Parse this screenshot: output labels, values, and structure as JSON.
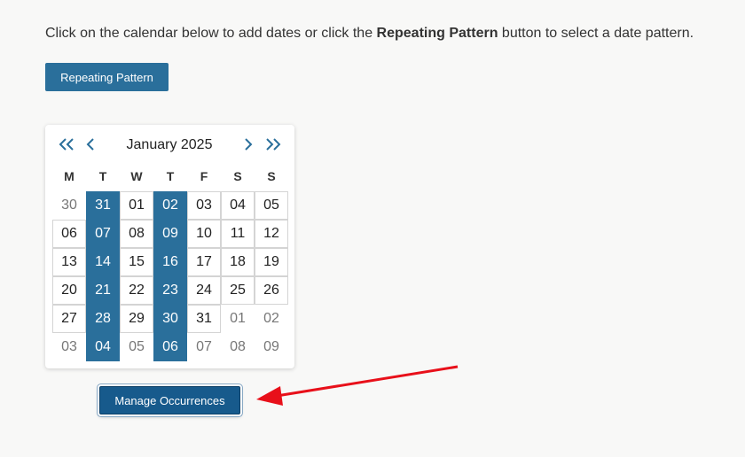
{
  "intro": {
    "before": "Click on the calendar below to add dates or click the ",
    "bold": "Repeating Pattern",
    "after": " button to select a date pattern."
  },
  "repeat_button": {
    "label": "Repeating Pattern"
  },
  "calendar": {
    "month_label": "January 2025",
    "weekdays": [
      "M",
      "T",
      "W",
      "T",
      "F",
      "S",
      "S"
    ],
    "weeks": [
      [
        {
          "d": "30",
          "state": "outside"
        },
        {
          "d": "31",
          "state": "selected"
        },
        {
          "d": "01",
          "state": "current"
        },
        {
          "d": "02",
          "state": "selected"
        },
        {
          "d": "03",
          "state": "current"
        },
        {
          "d": "04",
          "state": "current"
        },
        {
          "d": "05",
          "state": "current"
        }
      ],
      [
        {
          "d": "06",
          "state": "current"
        },
        {
          "d": "07",
          "state": "selected"
        },
        {
          "d": "08",
          "state": "current"
        },
        {
          "d": "09",
          "state": "selected"
        },
        {
          "d": "10",
          "state": "current"
        },
        {
          "d": "11",
          "state": "current"
        },
        {
          "d": "12",
          "state": "current"
        }
      ],
      [
        {
          "d": "13",
          "state": "current"
        },
        {
          "d": "14",
          "state": "selected"
        },
        {
          "d": "15",
          "state": "current"
        },
        {
          "d": "16",
          "state": "selected"
        },
        {
          "d": "17",
          "state": "current"
        },
        {
          "d": "18",
          "state": "current"
        },
        {
          "d": "19",
          "state": "current"
        }
      ],
      [
        {
          "d": "20",
          "state": "current"
        },
        {
          "d": "21",
          "state": "selected"
        },
        {
          "d": "22",
          "state": "current"
        },
        {
          "d": "23",
          "state": "selected"
        },
        {
          "d": "24",
          "state": "current"
        },
        {
          "d": "25",
          "state": "current"
        },
        {
          "d": "26",
          "state": "current"
        }
      ],
      [
        {
          "d": "27",
          "state": "current"
        },
        {
          "d": "28",
          "state": "selected"
        },
        {
          "d": "29",
          "state": "current"
        },
        {
          "d": "30",
          "state": "selected"
        },
        {
          "d": "31",
          "state": "current"
        },
        {
          "d": "01",
          "state": "outside"
        },
        {
          "d": "02",
          "state": "outside"
        }
      ],
      [
        {
          "d": "03",
          "state": "outside"
        },
        {
          "d": "04",
          "state": "selected"
        },
        {
          "d": "05",
          "state": "outside"
        },
        {
          "d": "06",
          "state": "selected"
        },
        {
          "d": "07",
          "state": "outside"
        },
        {
          "d": "08",
          "state": "outside"
        },
        {
          "d": "09",
          "state": "outside"
        }
      ]
    ]
  },
  "manage_button": {
    "label": "Manage Occurrences"
  },
  "colors": {
    "accent": "#2a6f9b",
    "manage_button": "#175a8c",
    "arrow": "#e8101a",
    "background": "#f8f8f7"
  },
  "icons": [
    "double-chevron-left-icon",
    "chevron-left-icon",
    "chevron-right-icon",
    "double-chevron-right-icon",
    "red-arrow-annotation"
  ]
}
